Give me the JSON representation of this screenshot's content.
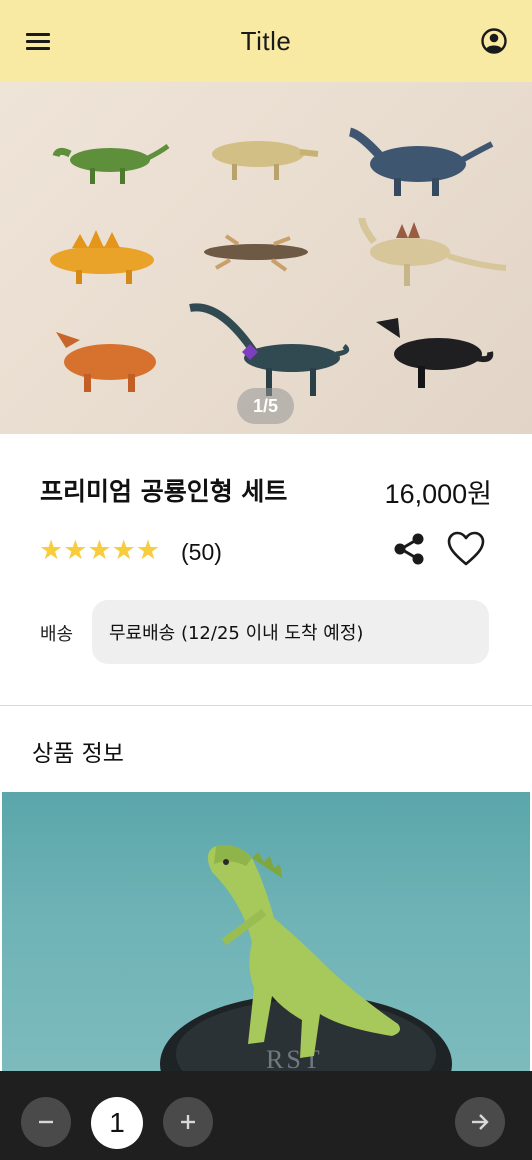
{
  "app_bar": {
    "title": "Title",
    "menu_icon": "hamburger-menu-icon",
    "account_icon": "account-circle-icon",
    "background": "#f8e9a3"
  },
  "hero": {
    "pager_text": "1/5",
    "current_page": 1,
    "total_pages": 5
  },
  "product": {
    "name": "프리미엄 공룡인형 세트",
    "price": "16,000원",
    "stars": "★★★★★",
    "rating": 5,
    "review_count": "(50)",
    "star_color": "#f7cc3d",
    "share_icon": "share-icon",
    "like_icon": "heart-outline-icon"
  },
  "shipping": {
    "label": "배송",
    "value": "무료배송 (12/25 이내 도착 예정)"
  },
  "section": {
    "title": "상품 정보"
  },
  "detail_image": {
    "embossed_text": "RST"
  },
  "bottom_bar": {
    "quantity": "1",
    "minus_icon": "minus-icon",
    "plus_icon": "plus-icon",
    "next_icon": "arrow-right-icon",
    "background": "#1f1f1f"
  }
}
